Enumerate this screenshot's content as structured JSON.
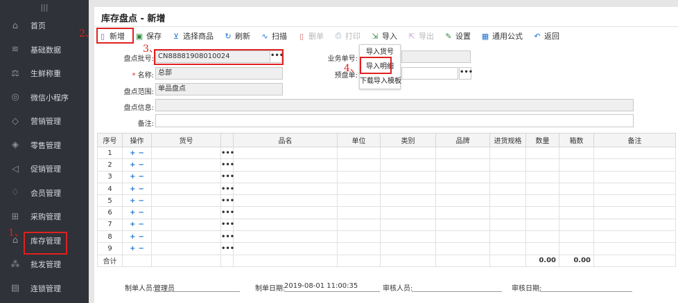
{
  "sidebar": {
    "items": [
      {
        "label": "首页",
        "icon": "home-icon",
        "glyph": "⌂"
      },
      {
        "label": "基础数据",
        "icon": "layers-icon",
        "glyph": "≋"
      },
      {
        "label": "生鲜称重",
        "icon": "scale-icon",
        "glyph": "⚖"
      },
      {
        "label": "微信小程序",
        "icon": "wechat-icon",
        "glyph": "◎"
      },
      {
        "label": "营销管理",
        "icon": "diamond-icon",
        "glyph": "◇"
      },
      {
        "label": "零售管理",
        "icon": "tag-icon",
        "glyph": "◈"
      },
      {
        "label": "促销管理",
        "icon": "megaphone-icon",
        "glyph": "◁"
      },
      {
        "label": "会员管理",
        "icon": "member-icon",
        "glyph": "♢"
      },
      {
        "label": "采购管理",
        "icon": "cart-icon",
        "glyph": "⊞"
      },
      {
        "label": "库存管理",
        "icon": "warehouse-icon",
        "glyph": "⌂"
      },
      {
        "label": "批发管理",
        "icon": "cluster-icon",
        "glyph": "⁂"
      },
      {
        "label": "连锁管理",
        "icon": "store-icon",
        "glyph": "▤"
      }
    ]
  },
  "page": {
    "title": "库存盘点 - 新增"
  },
  "toolbar": [
    {
      "label": "新增",
      "icon": "new-doc-icon",
      "glyph": "▯",
      "color": "#7b5bc6",
      "disabled": false
    },
    {
      "label": "保存",
      "icon": "save-icon",
      "glyph": "▣",
      "color": "#2e8b3e",
      "disabled": false
    },
    {
      "label": "选择商品",
      "icon": "cart-icon",
      "glyph": "⊻",
      "color": "#1e74d0",
      "disabled": false
    },
    {
      "label": "刷新",
      "icon": "refresh-icon",
      "glyph": "↻",
      "color": "#1e74d0",
      "disabled": false
    },
    {
      "label": "扫描",
      "icon": "scan-icon",
      "glyph": "∿",
      "color": "#1e74d0",
      "disabled": false
    },
    {
      "label": "删单",
      "icon": "delete-doc-icon",
      "glyph": "▯",
      "color": "#d96a6a",
      "disabled": true
    },
    {
      "label": "打印",
      "icon": "print-icon",
      "glyph": "⎙",
      "color": "#9ab",
      "disabled": true
    },
    {
      "label": "导入",
      "icon": "import-icon",
      "glyph": "⇲",
      "color": "#2e8b3e",
      "disabled": false
    },
    {
      "label": "导出",
      "icon": "export-icon",
      "glyph": "⇱",
      "color": "#c9a0d8",
      "disabled": true
    },
    {
      "label": "设置",
      "icon": "settings-icon",
      "glyph": "✎",
      "color": "#2e8b3e",
      "disabled": false
    },
    {
      "label": "通用公式",
      "icon": "formula-icon",
      "glyph": "▦",
      "color": "#1e74d0",
      "disabled": false
    },
    {
      "label": "返回",
      "icon": "back-icon",
      "glyph": "↶",
      "color": "#1e74d0",
      "disabled": false
    }
  ],
  "form": {
    "batch_label": "盘点批号:",
    "batch_value": "CN88881908010024",
    "name_required": "*",
    "name_label": "名称:",
    "name_value": "总部",
    "range_label": "盘点范围:",
    "range_value": "单品盘点",
    "info_label": "盘点信息:",
    "remark_label": "备注:",
    "business_label": "业务单号:",
    "pre_label": "预盘单:"
  },
  "import_menu": [
    "导入货号",
    "导入明细",
    "下载导入模板"
  ],
  "annotations": [
    "1、",
    "2、",
    "3、",
    "4、"
  ],
  "table": {
    "headers": [
      "序号",
      "操作",
      "货号",
      "",
      "品名",
      "单位",
      "类别",
      "品牌",
      "进货规格",
      "数量",
      "箱数",
      "备注"
    ],
    "rows": [
      "1",
      "2",
      "3",
      "4",
      "5",
      "6",
      "7",
      "8",
      "9"
    ],
    "dots": "•••",
    "plus": "+",
    "minus": "−",
    "total_label": "合计",
    "total_qty": "0.00",
    "total_box": "0.00"
  },
  "footer": {
    "creator_label": "制单人员:",
    "creator_value": "管理员",
    "date_label": "制单日期:",
    "date_value": "2019-08-01 11:00:35",
    "auditor_label": "审核人员:",
    "audit_date_label": "审核日期:"
  }
}
